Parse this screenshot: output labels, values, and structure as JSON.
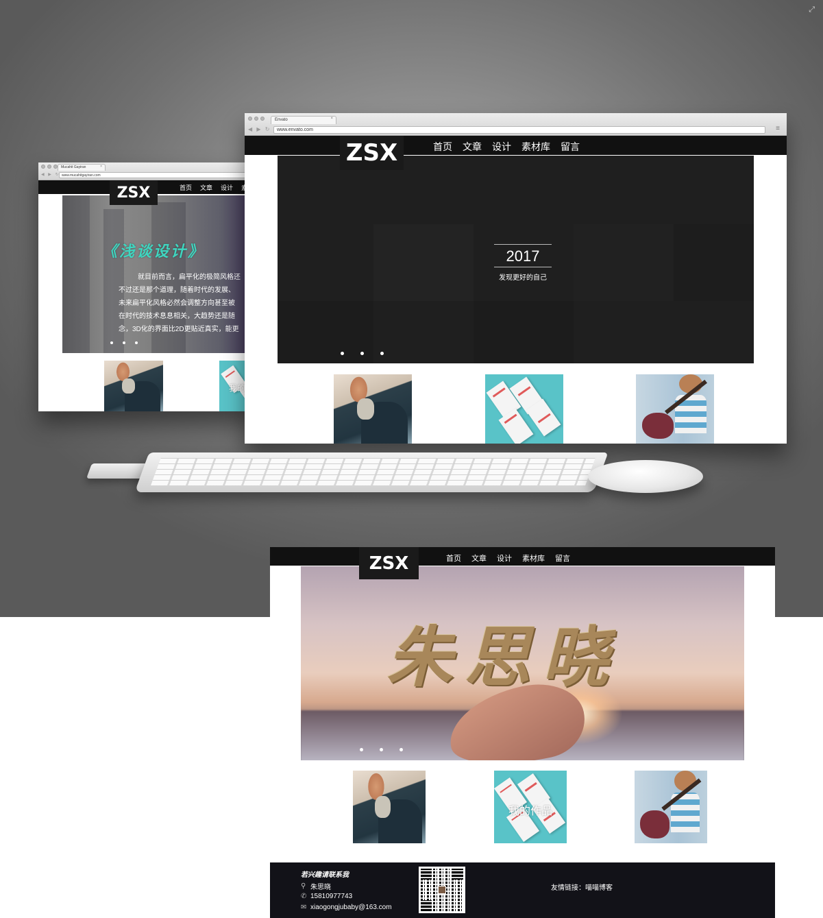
{
  "left_window": {
    "tab_title": "Mucahit Gayiran",
    "url": "www.mucahitgayiran.com",
    "logo": "ZSX",
    "nav": [
      "首页",
      "文章",
      "设计",
      "素"
    ],
    "hero": {
      "title": "《浅谈设计》",
      "paragraph": [
        "就目前而言，扁平化的极简风格还",
        "不过还是那个道理，随着时代的发展、",
        "未来扁平化风格必然会调整方向甚至被",
        "在时代的技术息息相关，大趋势还是随",
        "念，3D化的界面比2D更贴近真实，能更"
      ]
    },
    "thumb_overlay": "我的"
  },
  "main_window": {
    "tab_title": "Envato",
    "url": "www.envato.com",
    "logo": "ZSX",
    "nav": [
      "首页",
      "文章",
      "设计",
      "素材库",
      "留言"
    ],
    "hero": {
      "year": "2017",
      "subtitle": "发现更好的自己",
      "slides": 3
    }
  },
  "flat_page": {
    "logo": "ZSX",
    "nav": [
      "首页",
      "文章",
      "设计",
      "素材库",
      "留言"
    ],
    "hero_title": "朱思晓",
    "slides": 3,
    "thumb_overlay": "我的作品",
    "footer": {
      "title": "若兴趣请联系我",
      "name": "朱思晓",
      "phone": "15810977743",
      "email": "xiaogongjubaby@163.com",
      "links": "友情链接：喵喵博客"
    }
  },
  "icons": {
    "user": "person-icon",
    "phone": "phone-icon",
    "mail": "mail-icon"
  }
}
